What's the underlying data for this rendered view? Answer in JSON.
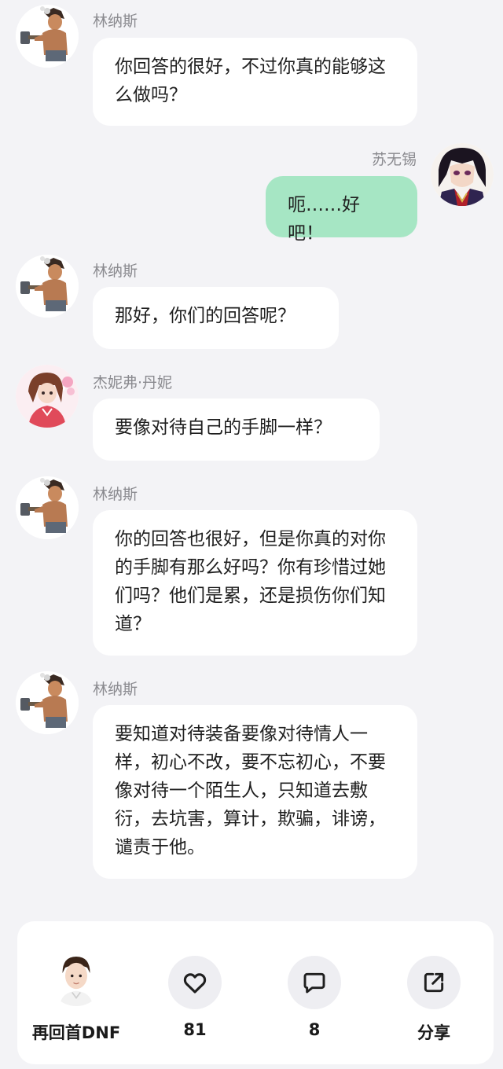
{
  "messages": [
    {
      "sender": "林纳斯",
      "text": "你回答的很好，不过你真的能够这么做吗？",
      "side": "left"
    },
    {
      "sender": "苏无锡",
      "text": "呃……好吧！",
      "side": "right"
    },
    {
      "sender": "林纳斯",
      "text": "那好，你们的回答呢？",
      "side": "left"
    },
    {
      "sender": "杰妮弗·丹妮",
      "text": "要像对待自己的手脚一样？",
      "side": "left"
    },
    {
      "sender": "林纳斯",
      "text": "你的回答也很好，但是你真的对你的手脚有那么好吗？你有珍惜过她们吗？他们是累，还是损伤你们知道？",
      "side": "left"
    },
    {
      "sender": "林纳斯",
      "text": "要知道对待装备要像对待情人一样，初心不改，要不忘初心，不要像对待一个陌生人，只知道去敷衍，去坑害，算计，欺骗，诽谤，谴责于他。",
      "side": "left"
    }
  ],
  "bottom_bar": {
    "author": "再回首DNF",
    "like_count": "81",
    "comment_count": "8",
    "share_label": "分享"
  },
  "icons": {
    "like": "heart-icon",
    "comment": "comment-icon",
    "share": "share-icon"
  },
  "colors": {
    "background": "#f3f3f6",
    "bubble_other": "#ffffff",
    "bubble_me": "#a6e6c4",
    "name_text": "#8a8a8f"
  }
}
